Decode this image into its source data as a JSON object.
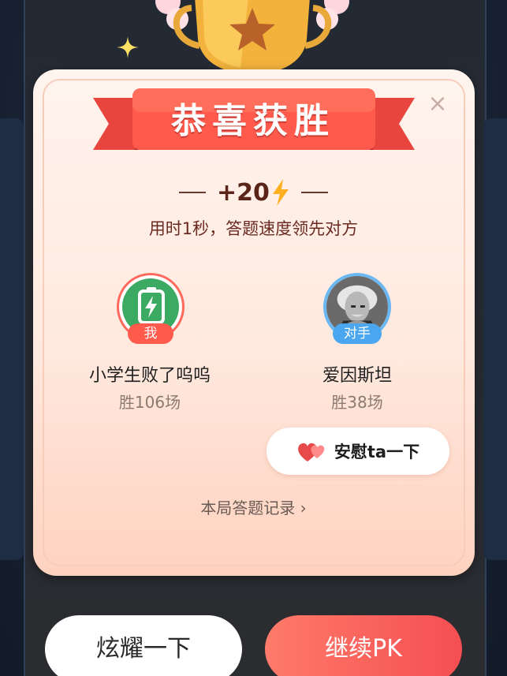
{
  "dialog": {
    "title": "恭喜获胜",
    "score": "+20",
    "subtitle": "用时1秒，答题速度领先对方",
    "close_icon": "close-icon"
  },
  "me": {
    "tag": "我",
    "name": "小学生败了呜呜",
    "wins": "胜106场"
  },
  "opponent": {
    "tag": "对手",
    "name": "爱因斯坦",
    "wins": "胜38场"
  },
  "actions": {
    "comfort_label": "安慰ta一下",
    "record_link": "本局答题记录 ›",
    "show_off_label": "炫耀一下",
    "continue_label": "继续PK"
  },
  "colors": {
    "accent_red": "#f44f52",
    "ribbon_red": "#ff5a4c",
    "opponent_blue": "#4aa6ef",
    "avatar_green": "#3daa63"
  }
}
